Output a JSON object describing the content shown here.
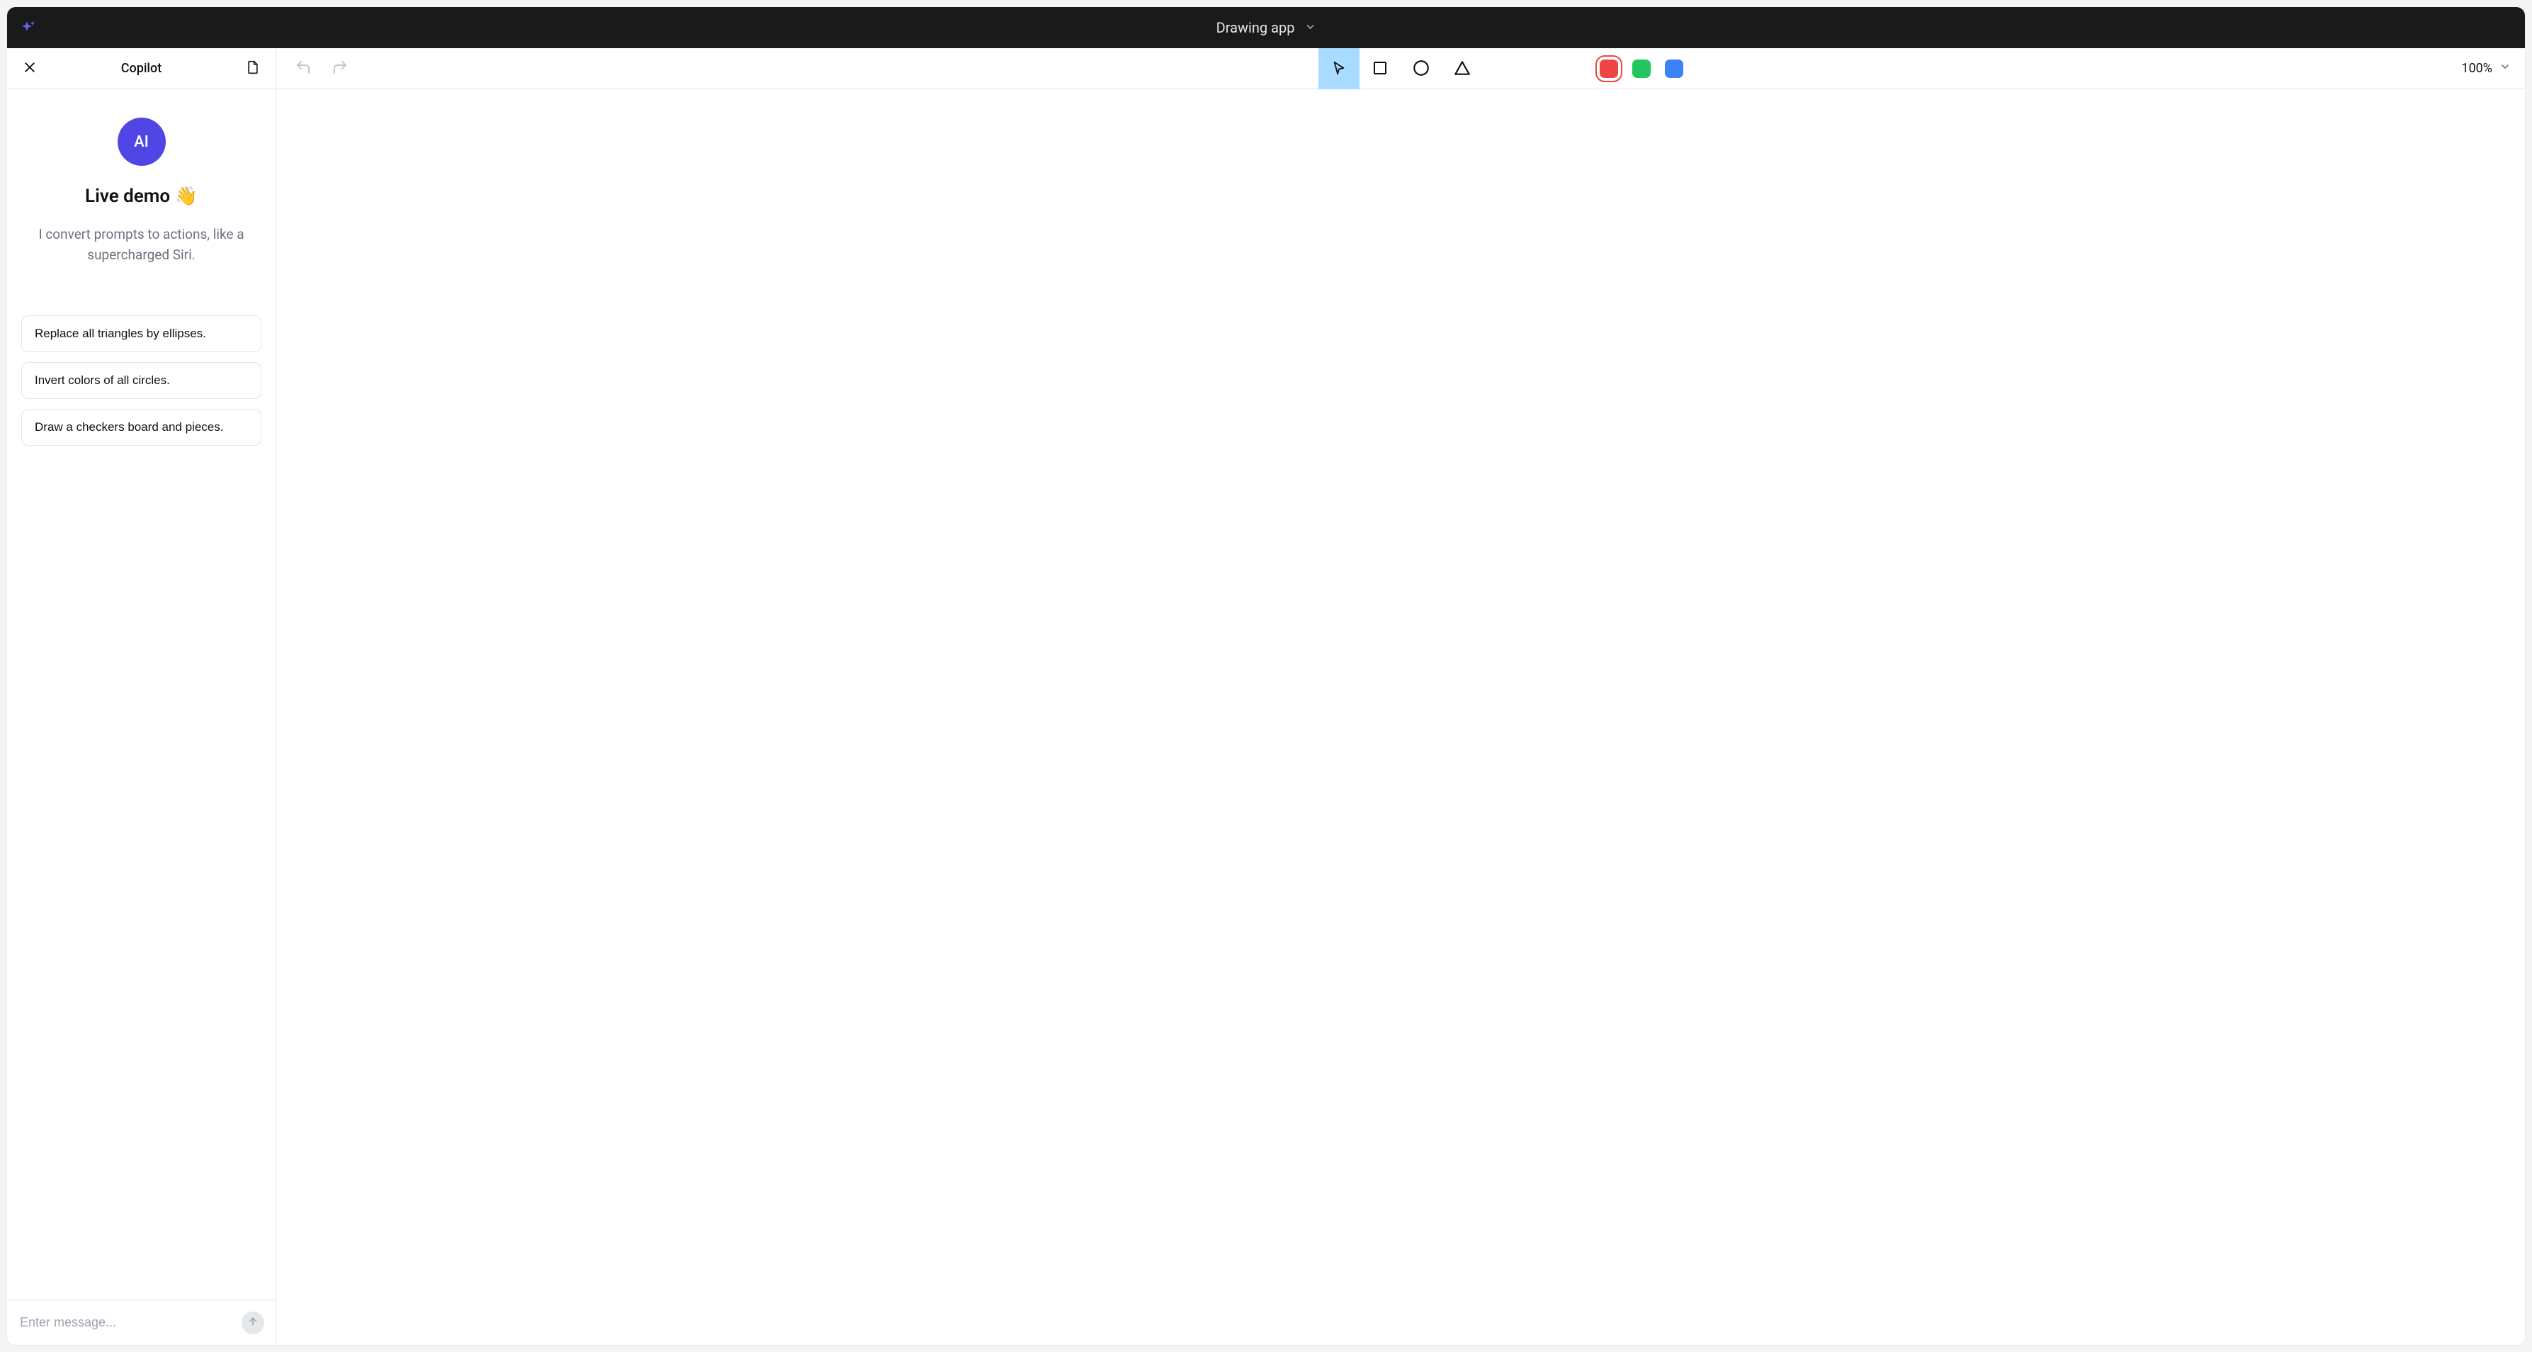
{
  "header": {
    "app_title": "Drawing app"
  },
  "sidebar": {
    "title": "Copilot",
    "avatar_label": "AI",
    "welcome_title": "Live demo 👋",
    "welcome_desc": "I convert prompts to actions, like a supercharged Siri.",
    "suggestions": [
      "Replace all triangles by ellipses.",
      "Invert colors of all circles.",
      "Draw a checkers board and pieces."
    ],
    "input_placeholder": "Enter message..."
  },
  "toolbar": {
    "tools": {
      "pointer": "pointer",
      "rectangle": "rectangle",
      "circle": "circle",
      "triangle": "triangle"
    },
    "active_tool": "pointer",
    "colors": {
      "red": "#ef4444",
      "green": "#22c55e",
      "blue": "#3b82f6"
    },
    "selected_color": "red",
    "zoom_label": "100%"
  }
}
